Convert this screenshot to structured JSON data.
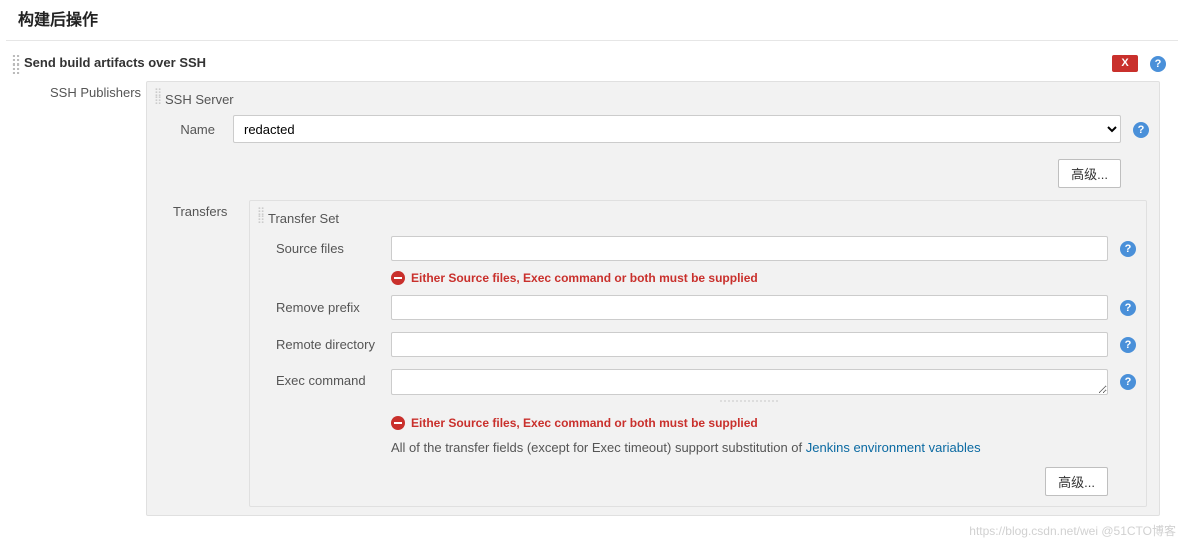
{
  "section_title": "构建后操作",
  "step_title": "Send build artifacts over SSH",
  "labels": {
    "ssh_publishers": "SSH Publishers",
    "ssh_server": "SSH Server",
    "name": "Name",
    "transfers": "Transfers",
    "transfer_set": "Transfer Set",
    "source_files": "Source files",
    "remove_prefix": "Remove prefix",
    "remote_directory": "Remote directory",
    "exec_command": "Exec command"
  },
  "buttons": {
    "advanced": "高级...",
    "close": "X"
  },
  "fields": {
    "name_value": "redacted",
    "source_files": "",
    "remove_prefix": "",
    "remote_directory": "",
    "exec_command": ""
  },
  "errors": {
    "supply_msg": "Either Source files, Exec command or both must be supplied"
  },
  "note_prefix": "All of the transfer fields (except for Exec timeout) support substitution of ",
  "note_link": "Jenkins environment variables",
  "watermark": "https://blog.csdn.net/wei  @51CTO博客"
}
